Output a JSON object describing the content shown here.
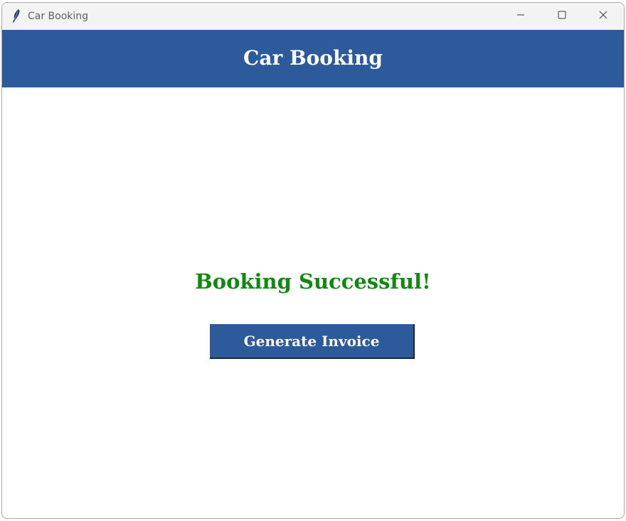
{
  "window": {
    "title": "Car Booking",
    "icons": {
      "app": "feather-icon",
      "minimize": "minimize-icon",
      "maximize": "maximize-icon",
      "close": "close-icon"
    }
  },
  "header": {
    "title": "Car Booking"
  },
  "main": {
    "status_message": "Booking Successful!",
    "invoice_button_label": "Generate Invoice"
  },
  "colors": {
    "header_bg": "#2c5a9b",
    "button_bg": "#2c5a9b",
    "success_text": "#0f8a0f",
    "header_text": "#ffffff"
  }
}
